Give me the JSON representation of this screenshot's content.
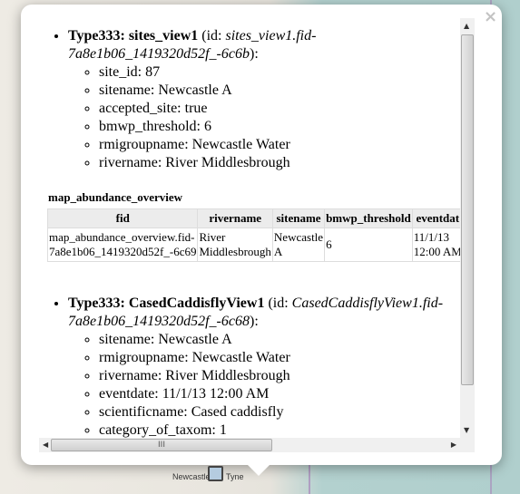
{
  "close_label": "×",
  "features": [
    {
      "type": "Type333: sites_view1",
      "id_prefix": " (id: ",
      "id": "sites_view1.fid-7a8e1b06_1419320d52f_-6c6b",
      "id_suffix": "):",
      "attributes": [
        "site_id: 87",
        "sitename: Newcastle A",
        "accepted_site: true",
        "bmwp_threshold: 6",
        "rmigroupname: Newcastle Water",
        "rivername: River Middlesbrough"
      ]
    },
    {
      "type": "Type333: CasedCaddisflyView1",
      "id_prefix": " (id: ",
      "id": "CasedCaddisflyView1.fid-7a8e1b06_1419320d52f_-6c68",
      "id_suffix": "):",
      "attributes": [
        "sitename: Newcastle A",
        "rmigroupname: Newcastle Water",
        "rivername: River Middlesbrough",
        "eventdate: 11/1/13 12:00 AM",
        "scientificname: Cased caddisfly",
        "category_of_taxom: 1"
      ]
    }
  ],
  "table": {
    "title": "map_abundance_overview",
    "headers": [
      "fid",
      "rivername",
      "sitename",
      "bmwp_threshold",
      "eventdat"
    ],
    "rows": [
      [
        "map_abundance_overview.fid-",
        "River",
        "Newcastle",
        "6",
        "11/1/13"
      ],
      [
        "7a8e1b06_1419320d52f_-6c69",
        "Middlesbrough",
        "A",
        "",
        "12:00 AM"
      ]
    ]
  },
  "scrollbar": {
    "thumb_grip": "III"
  },
  "map_labels": {
    "left": "Newcastle",
    "right": "Tyne"
  }
}
